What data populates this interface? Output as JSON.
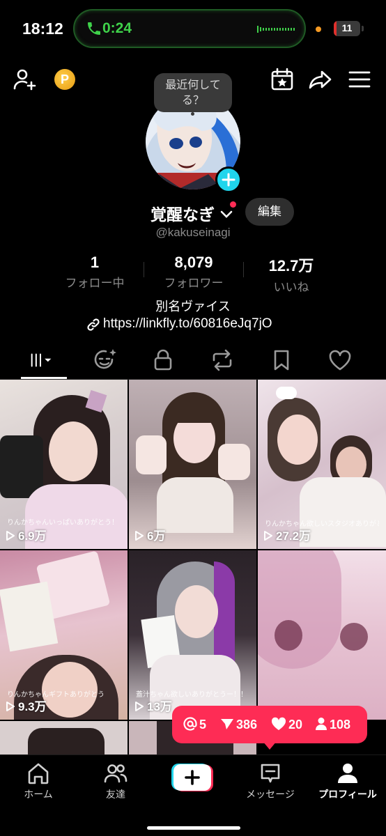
{
  "status_bar": {
    "time": "18:12",
    "call_time": "0:24",
    "battery": "11",
    "battery_level": 0.11
  },
  "top_bar": {
    "coin_letter": "P"
  },
  "profile": {
    "bubble_text": "最近何して る？",
    "display_name": "覚醒なぎ",
    "edit_label": "編集",
    "handle": "@kakuseinagi",
    "stats": {
      "following_count": "1",
      "following_label": "フォロー中",
      "followers_count": "8,079",
      "followers_label": "フォロワー",
      "likes_count": "12.7万",
      "likes_label": "いいね"
    },
    "nickname": "別名ヴァイス",
    "link": "https://linkfly.to/60816eJq7jO"
  },
  "tabs": [
    {
      "name": "videos",
      "icon": "grid-icon"
    },
    {
      "name": "reposts-avatar",
      "icon": "face-sparkle-icon"
    },
    {
      "name": "private",
      "icon": "lock-icon"
    },
    {
      "name": "repost",
      "icon": "repost-icon"
    },
    {
      "name": "favorites",
      "icon": "bookmark-icon"
    },
    {
      "name": "liked",
      "icon": "heart-icon"
    }
  ],
  "videos": [
    {
      "views": "6.9万",
      "caption": "りんかちゃんいっぱいありがとう！"
    },
    {
      "views": "6万",
      "caption": ""
    },
    {
      "views": "27.2万",
      "caption": "りんかちゃん欲しいスタジオありがとう！"
    },
    {
      "views": "9.3万",
      "caption": "りんかちゃんギフトありがとう"
    },
    {
      "views": "13万",
      "caption": "蓋汁ちゃん欲しいありがとうー！！"
    },
    {
      "views": "",
      "caption": ""
    }
  ],
  "notifications": {
    "mentions": "5",
    "shares": "386",
    "likes": "20",
    "followers": "108"
  },
  "bottom_nav": {
    "home": "ホーム",
    "friends": "友達",
    "inbox": "メッセージ",
    "profile": "プロフィール"
  },
  "colors": {
    "accent": "#fe2c55",
    "teal": "#20d5ec",
    "call_green": "#3fd14a"
  }
}
